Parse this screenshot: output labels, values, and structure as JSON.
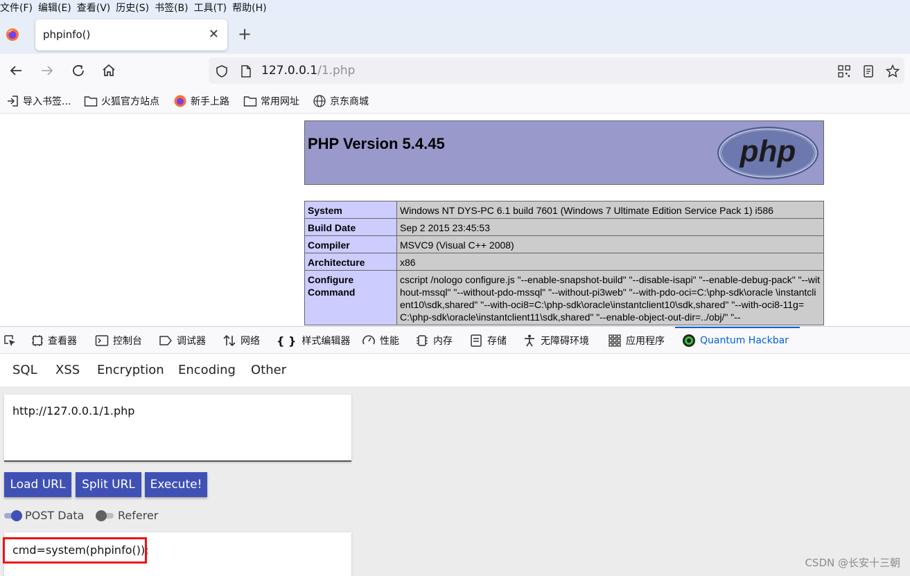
{
  "menubar": {
    "items": [
      "文件(F)",
      "编辑(E)",
      "查看(V)",
      "历史(S)",
      "书签(B)",
      "工具(T)",
      "帮助(H)"
    ]
  },
  "tab": {
    "title": "phpinfo()",
    "close_glyph": "✕",
    "new_tab_glyph": "+"
  },
  "address": {
    "host": "127.0.0.1",
    "path": "/1.php"
  },
  "bookmarks": {
    "items": [
      "导入书签...",
      "火狐官方站点",
      "新手上路",
      "常用网址",
      "京东商城"
    ]
  },
  "phpinfo": {
    "heading": "PHP Version 5.4.45",
    "logo_text": "php",
    "rows": [
      {
        "key": "System",
        "value": "Windows NT DYS-PC 6.1 build 7601 (Windows 7 Ultimate Edition Service Pack 1) i586"
      },
      {
        "key": "Build Date",
        "value": "Sep 2 2015 23:45:53"
      },
      {
        "key": "Compiler",
        "value": "MSVC9 (Visual C++ 2008)"
      },
      {
        "key": "Architecture",
        "value": "x86"
      },
      {
        "key": "Configure Command",
        "value": "cscript /nologo configure.js \"--enable-snapshot-build\" \"--disable-isapi\" \"--enable-debug-pack\" \"--without-mssql\" \"--without-pdo-mssql\" \"--without-pi3web\" \"--with-pdo-oci=C:\\php-sdk\\oracle \\instantclient10\\sdk,shared\" \"--with-oci8=C:\\php-sdk\\oracle\\instantclient10\\sdk,shared\" \"--with-oci8-11g=C:\\php-sdk\\oracle\\instantclient11\\sdk,shared\" \"--enable-object-out-dir=../obj/\" \"--"
      }
    ]
  },
  "devtools": {
    "tabs": [
      "查看器",
      "控制台",
      "调试器",
      "网络",
      "样式编辑器",
      "性能",
      "内存",
      "存储",
      "无障碍环境",
      "应用程序",
      "Quantum Hackbar"
    ],
    "active": "Quantum Hackbar",
    "active_color": "#0061e0"
  },
  "hackbar": {
    "menu": [
      "SQL",
      "XSS",
      "Encryption",
      "Encoding",
      "Other"
    ],
    "url_value": "http://127.0.0.1/1.php",
    "buttons": [
      "Load URL",
      "Split URL",
      "Execute!"
    ],
    "button_color": "#3f51b5",
    "toggles": [
      {
        "label": "POST Data",
        "on": true
      },
      {
        "label": "Referer",
        "on": false
      }
    ],
    "post_value": "cmd=system(phpinfo());",
    "highlight_color": "#e11111"
  },
  "watermark": "CSDN @长安十三朝"
}
